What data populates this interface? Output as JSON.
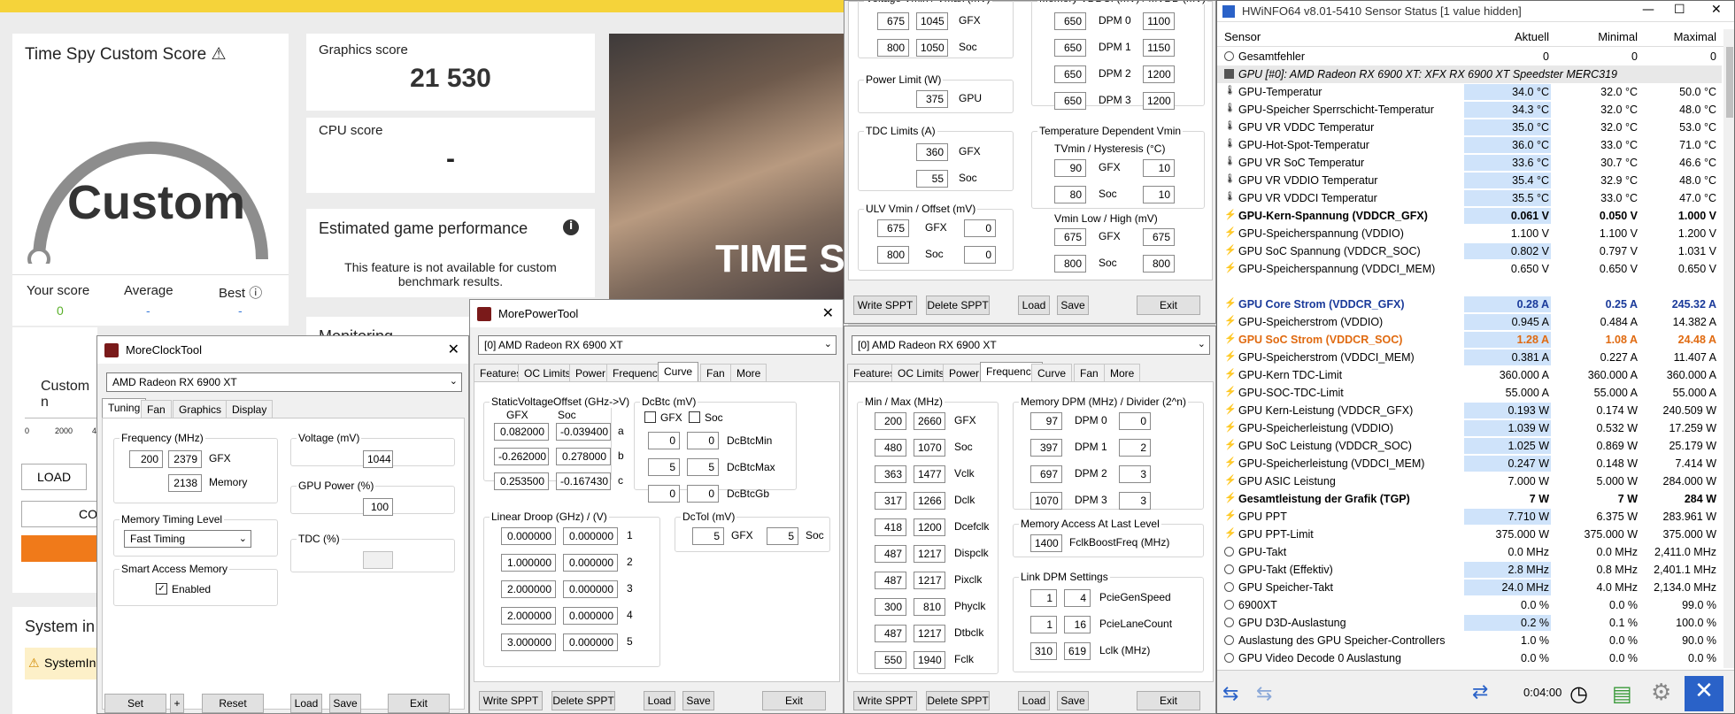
{
  "tdm": {
    "title": "Time Spy Custom Score",
    "score_word": "Custom",
    "your_score_label": "Your score",
    "your_score_value": "0",
    "average_label": "Average",
    "average_value": "-",
    "best_label": "Best",
    "best_value": "-",
    "graphics_label": "Graphics score",
    "graphics_value": "21 530",
    "cpu_label": "CPU score",
    "cpu_value": "-",
    "est_title": "Estimated game performance",
    "est_text": "This feature is not available for custom benchmark results.",
    "monitoring": "Monitoring",
    "custom_trunc": "Custom n",
    "load": "LOAD",
    "co": "CO",
    "system_info": "System in",
    "system_warn": "SystemIn",
    "axis0": "0",
    "axis1": "2000",
    "axis2": "4",
    "hero_text": "TIME SP"
  },
  "mct": {
    "title": "MoreClockTool",
    "gpu": "AMD Radeon RX 6900 XT",
    "tabs": [
      "Tuning",
      "Fan",
      "Graphics",
      "Display"
    ],
    "freq_label": "Frequency (MHz)",
    "freq_min": "200",
    "freq_max": "2379",
    "gfx": "GFX",
    "mem_val": "2138",
    "mem_label": "Memory",
    "timing_label": "Memory Timing Level",
    "timing_value": "Fast Timing",
    "sam_label": "Smart Access Memory",
    "sam_enabled": "Enabled",
    "volt_label": "Voltage (mV)",
    "volt_value": "1044",
    "power_label": "GPU Power (%)",
    "power_value": "100",
    "tdc_label": "TDC (%)",
    "buttons": {
      "set": "Set",
      "plus": "+",
      "reset": "Reset",
      "load": "Load",
      "save": "Save",
      "exit": "Exit"
    }
  },
  "mpt1": {
    "title": "MorePowerTool",
    "gpu": "[0] AMD Radeon RX 6900 XT",
    "tabs": [
      "Features",
      "OC Limits",
      "Power",
      "Frequency",
      "Curve",
      "Fan",
      "More"
    ],
    "svo_label": "StaticVoltageOffset (GHz->V)",
    "svo_gfx": "GFX",
    "svo_soc": "Soc",
    "svo_rows": [
      {
        "g": "0.082000",
        "s": "-0.039400",
        "k": "a"
      },
      {
        "g": "-0.262000",
        "s": "0.278000",
        "k": "b"
      },
      {
        "g": "0.253500",
        "s": "-0.167430",
        "k": "c"
      }
    ],
    "dcbtc_label": "DcBtc (mV)",
    "dcbtc_gfx": "GFX",
    "dcbtc_soc": "Soc",
    "dcbtc_rows": [
      {
        "g": "0",
        "s": "0",
        "k": "DcBtcMin"
      },
      {
        "g": "5",
        "s": "5",
        "k": "DcBtcMax"
      },
      {
        "g": "0",
        "s": "0",
        "k": "DcBtcGb"
      }
    ],
    "droop_label": "Linear Droop (GHz) / (V)",
    "droop_rows": [
      {
        "g": "0.000000",
        "s": "0.000000",
        "k": "1"
      },
      {
        "g": "1.000000",
        "s": "0.000000",
        "k": "2"
      },
      {
        "g": "2.000000",
        "s": "0.000000",
        "k": "3"
      },
      {
        "g": "2.000000",
        "s": "0.000000",
        "k": "4"
      },
      {
        "g": "3.000000",
        "s": "0.000000",
        "k": "5"
      }
    ],
    "dctol_label": "DcTol (mV)",
    "dctol_g": "5",
    "dctol_gfx": "GFX",
    "dctol_s": "5",
    "dctol_soc": "Soc",
    "buttons": {
      "write": "Write SPPT",
      "delete": "Delete SPPT",
      "load": "Load",
      "save": "Save",
      "exit": "Exit"
    }
  },
  "mpt2": {
    "vminmax_label": "Voltage Vmin / Vmax (mV)",
    "v_rows": [
      {
        "a": "675",
        "b": "1045",
        "k": "GFX"
      },
      {
        "a": "800",
        "b": "1050",
        "k": "Soc"
      }
    ],
    "vddci_label": "Memory VDDCI (mV) / MVDD (mV)",
    "vddci_rows": [
      {
        "a": "650",
        "k": "DPM 0",
        "b": "1100"
      },
      {
        "a": "650",
        "k": "DPM 1",
        "b": "1150"
      },
      {
        "a": "650",
        "k": "DPM 2",
        "b": "1200"
      },
      {
        "a": "650",
        "k": "DPM 3",
        "b": "1200"
      }
    ],
    "pl_label": "Power Limit (W)",
    "pl_value": "375",
    "pl_gpu": "GPU",
    "tdc_label": "TDC Limits (A)",
    "tdc_rows": [
      {
        "a": "360",
        "k": "GFX"
      },
      {
        "a": "55",
        "k": "Soc"
      }
    ],
    "tdv_label": "Temperature Dependent Vmin",
    "tvmin_label": "TVmin / Hysteresis (°C)",
    "tv_rows": [
      {
        "a": "90",
        "k": "GFX",
        "b": "10"
      },
      {
        "a": "80",
        "k": "Soc",
        "b": "10"
      }
    ],
    "ulv_label": "ULV Vmin / Offset (mV)",
    "ulv_rows": [
      {
        "a": "675",
        "k": "GFX",
        "b": "0"
      },
      {
        "a": "800",
        "k": "Soc",
        "b": "0"
      }
    ],
    "vlow_label": "Vmin Low / High (mV)",
    "vlow_rows": [
      {
        "a": "675",
        "k": "GFX",
        "b": "675"
      },
      {
        "a": "800",
        "k": "Soc",
        "b": "800"
      }
    ],
    "buttons": {
      "write": "Write SPPT",
      "delete": "Delete SPPT",
      "load": "Load",
      "save": "Save",
      "exit": "Exit"
    }
  },
  "mpt3": {
    "gpu": "[0] AMD Radeon RX 6900 XT",
    "tabs": [
      "Features",
      "OC Limits",
      "Power",
      "Frequency",
      "Curve",
      "Fan",
      "More"
    ],
    "mm_label": "Min / Max (MHz)",
    "mm_rows": [
      {
        "a": "200",
        "b": "2660",
        "k": "GFX"
      },
      {
        "a": "480",
        "b": "1070",
        "k": "Soc"
      },
      {
        "a": "363",
        "b": "1477",
        "k": "Vclk"
      },
      {
        "a": "317",
        "b": "1266",
        "k": "Dclk"
      },
      {
        "a": "418",
        "b": "1200",
        "k": "Dcefclk"
      },
      {
        "a": "487",
        "b": "1217",
        "k": "Dispclk"
      },
      {
        "a": "487",
        "b": "1217",
        "k": "Pixclk"
      },
      {
        "a": "300",
        "b": "810",
        "k": "Phyclk"
      },
      {
        "a": "487",
        "b": "1217",
        "k": "Dtbclk"
      },
      {
        "a": "550",
        "b": "1940",
        "k": "Fclk"
      }
    ],
    "mdpm_label": "Memory DPM (MHz) / Divider (2^n)",
    "mdpm_rows": [
      {
        "a": "97",
        "k": "DPM 0",
        "b": "0"
      },
      {
        "a": "397",
        "k": "DPM 1",
        "b": "2"
      },
      {
        "a": "697",
        "k": "DPM 2",
        "b": "3"
      },
      {
        "a": "1070",
        "k": "DPM 3",
        "b": "3"
      }
    ],
    "maal_label": "Memory Access At Last Level",
    "maal_value": "1400",
    "maal_k": "FclkBoostFreq (MHz)",
    "link_label": "Link DPM Settings",
    "link_rows": [
      {
        "a": "1",
        "b": "4",
        "k": "PcieGenSpeed"
      },
      {
        "a": "1",
        "b": "16",
        "k": "PcieLaneCount"
      },
      {
        "a": "310",
        "b": "619",
        "k": "Lclk (MHz)"
      }
    ],
    "buttons": {
      "write": "Write SPPT",
      "delete": "Delete SPPT",
      "load": "Load",
      "save": "Save",
      "exit": "Exit"
    }
  },
  "hw": {
    "title": "HWiNFO64 v8.01-5410 Sensor Status [1 value hidden]",
    "col_sensor": "Sensor",
    "col_cur": "Aktuell",
    "col_min": "Minimal",
    "col_max": "Maximal",
    "time": "0:04:00",
    "rows": [
      {
        "n": "Gesamtfehler",
        "a": "0",
        "b": "0",
        "c": "0",
        "t": "gear"
      },
      {
        "n": "GPU [#0]: AMD Radeon RX 6900 XT: XFX RX 6900 XT Speedster MERC319",
        "a": "",
        "b": "",
        "c": "",
        "t": "hdr"
      },
      {
        "n": "GPU-Temperatur",
        "a": "34.0 °C",
        "b": "32.0 °C",
        "c": "50.0 °C",
        "t": "temp",
        "h": true
      },
      {
        "n": "GPU-Speicher Sperrschicht-Temperatur",
        "a": "34.3 °C",
        "b": "32.0 °C",
        "c": "48.0 °C",
        "t": "temp",
        "h": true
      },
      {
        "n": "GPU VR VDDC Temperatur",
        "a": "35.0 °C",
        "b": "32.0 °C",
        "c": "53.0 °C",
        "t": "temp",
        "h": true
      },
      {
        "n": "GPU-Hot-Spot-Temperatur",
        "a": "36.0 °C",
        "b": "33.0 °C",
        "c": "71.0 °C",
        "t": "temp",
        "h": true
      },
      {
        "n": "GPU VR SoC Temperatur",
        "a": "33.6 °C",
        "b": "30.7 °C",
        "c": "46.6 °C",
        "t": "temp",
        "h": true
      },
      {
        "n": "GPU VR VDDIO Temperatur",
        "a": "35.4 °C",
        "b": "32.9 °C",
        "c": "48.0 °C",
        "t": "temp",
        "h": true
      },
      {
        "n": "GPU VR VDDCI Temperatur",
        "a": "35.5 °C",
        "b": "33.0 °C",
        "c": "47.0 °C",
        "t": "temp",
        "h": true
      },
      {
        "n": "GPU-Kern-Spannung (VDDCR_GFX)",
        "a": "0.061 V",
        "b": "0.050 V",
        "c": "1.000 V",
        "t": "bolt",
        "bold": true,
        "h": true
      },
      {
        "n": "GPU-Speicherspannung (VDDIO)",
        "a": "1.100 V",
        "b": "1.100 V",
        "c": "1.200 V",
        "t": "bolt"
      },
      {
        "n": "GPU SoC Spannung (VDDCR_SOC)",
        "a": "0.802 V",
        "b": "0.797 V",
        "c": "1.031 V",
        "t": "bolt",
        "h": true
      },
      {
        "n": "GPU-Speicherspannung (VDDCI_MEM)",
        "a": "0.650 V",
        "b": "0.650 V",
        "c": "0.650 V",
        "t": "bolt"
      },
      {
        "n": "",
        "a": "",
        "b": "",
        "c": "",
        "t": "none"
      },
      {
        "n": "GPU Core Strom (VDDCR_GFX)",
        "a": "0.28 A",
        "b": "0.25 A",
        "c": "245.32 A",
        "t": "bolt",
        "bold": true,
        "col": "#1a3a9a",
        "h": true
      },
      {
        "n": "GPU-Speicherstrom (VDDIO)",
        "a": "0.945 A",
        "b": "0.484 A",
        "c": "14.382 A",
        "t": "bolt",
        "h": true
      },
      {
        "n": "GPU SoC Strom (VDDCR_SOC)",
        "a": "1.28 A",
        "b": "1.08 A",
        "c": "24.48 A",
        "t": "bolt",
        "bold": true,
        "col": "#e06a10",
        "h": true
      },
      {
        "n": "GPU-Speicherstrom (VDDCI_MEM)",
        "a": "0.381 A",
        "b": "0.227 A",
        "c": "11.407 A",
        "t": "bolt",
        "h": true
      },
      {
        "n": "GPU-Kern TDC-Limit",
        "a": "360.000 A",
        "b": "360.000 A",
        "c": "360.000 A",
        "t": "bolt"
      },
      {
        "n": "GPU-SOC-TDC-Limit",
        "a": "55.000 A",
        "b": "55.000 A",
        "c": "55.000 A",
        "t": "bolt"
      },
      {
        "n": "GPU Kern-Leistung (VDDCR_GFX)",
        "a": "0.193 W",
        "b": "0.174 W",
        "c": "240.509 W",
        "t": "bolt",
        "h": true
      },
      {
        "n": "GPU-Speicherleistung (VDDIO)",
        "a": "1.039 W",
        "b": "0.532 W",
        "c": "17.259 W",
        "t": "bolt",
        "h": true
      },
      {
        "n": "GPU SoC Leistung (VDDCR_SOC)",
        "a": "1.025 W",
        "b": "0.869 W",
        "c": "25.179 W",
        "t": "bolt",
        "h": true
      },
      {
        "n": "GPU-Speicherleistung (VDDCI_MEM)",
        "a": "0.247 W",
        "b": "0.148 W",
        "c": "7.414 W",
        "t": "bolt",
        "h": true
      },
      {
        "n": "GPU ASIC Leistung",
        "a": "7.000 W",
        "b": "5.000 W",
        "c": "284.000 W",
        "t": "bolt"
      },
      {
        "n": "Gesamtleistung der Grafik (TGP)",
        "a": "7 W",
        "b": "7 W",
        "c": "284 W",
        "t": "bolt",
        "bold": true
      },
      {
        "n": "GPU PPT",
        "a": "7.710 W",
        "b": "6.375 W",
        "c": "283.961 W",
        "t": "bolt",
        "h": true
      },
      {
        "n": "GPU PPT-Limit",
        "a": "375.000 W",
        "b": "375.000 W",
        "c": "375.000 W",
        "t": "bolt"
      },
      {
        "n": "GPU-Takt",
        "a": "0.0 MHz",
        "b": "0.0 MHz",
        "c": "2,411.0 MHz",
        "t": "gear"
      },
      {
        "n": "GPU-Takt (Effektiv)",
        "a": "2.8 MHz",
        "b": "0.8 MHz",
        "c": "2,401.1 MHz",
        "t": "gear",
        "h": true
      },
      {
        "n": "GPU Speicher-Takt",
        "a": "24.0 MHz",
        "b": "4.0 MHz",
        "c": "2,134.0 MHz",
        "t": "gear",
        "h": true
      },
      {
        "n": "6900XT",
        "a": "0.0 %",
        "b": "0.0 %",
        "c": "99.0 %",
        "t": "gear"
      },
      {
        "n": "GPU D3D-Auslastung",
        "a": "0.2 %",
        "b": "0.1 %",
        "c": "100.0 %",
        "t": "gear",
        "h": true
      },
      {
        "n": "Auslastung des GPU Speicher-Controllers",
        "a": "1.0 %",
        "b": "0.0 %",
        "c": "90.0 %",
        "t": "gear"
      },
      {
        "n": "GPU Video Decode 0 Auslastung",
        "a": "0.0 %",
        "b": "0.0 %",
        "c": "0.0 %",
        "t": "gear"
      }
    ]
  }
}
